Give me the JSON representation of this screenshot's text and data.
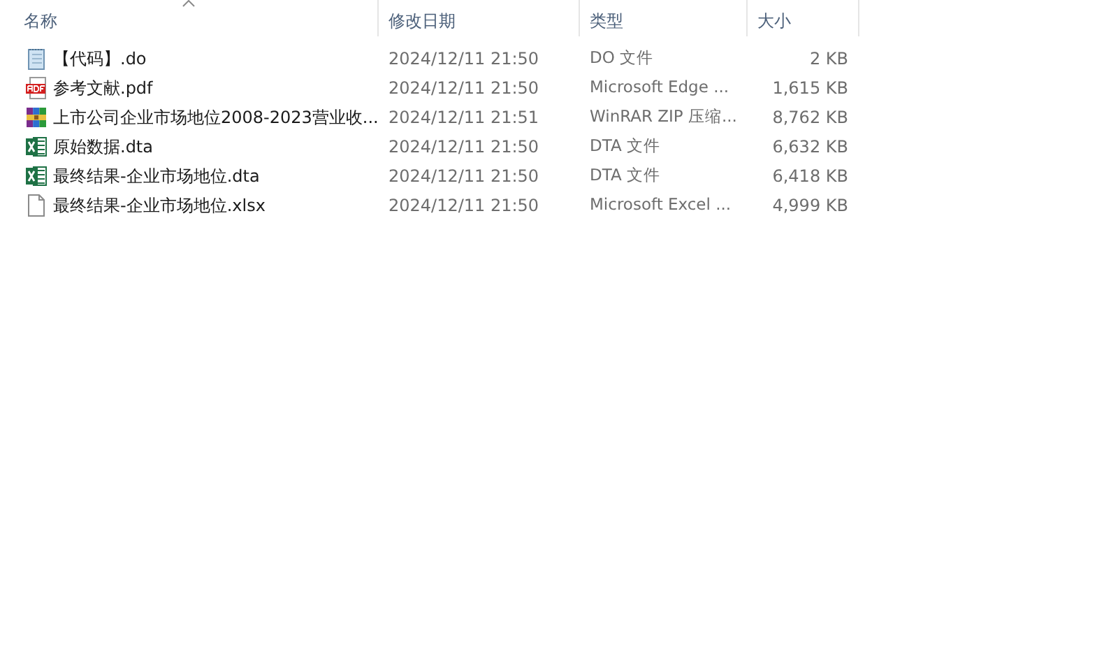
{
  "columns": [
    {
      "label": "名称",
      "sorted": true
    },
    {
      "label": "修改日期",
      "sorted": false
    },
    {
      "label": "类型",
      "sorted": false
    },
    {
      "label": "大小",
      "sorted": false
    }
  ],
  "files": [
    {
      "kind": "text",
      "name": "【代码】.do",
      "modified": "2024/12/11 21:50",
      "type": "DO 文件",
      "size": "2 KB"
    },
    {
      "kind": "pdf",
      "name": "参考文献.pdf",
      "modified": "2024/12/11 21:50",
      "type": "Microsoft Edge ...",
      "size": "1,615 KB"
    },
    {
      "kind": "archive",
      "name": "上市公司企业市场地位2008-2023营业收...",
      "modified": "2024/12/11 21:51",
      "type": "WinRAR ZIP 压缩...",
      "size": "8,762 KB"
    },
    {
      "kind": "excel",
      "name": "原始数据.dta",
      "modified": "2024/12/11 21:50",
      "type": "DTA 文件",
      "size": "6,632 KB"
    },
    {
      "kind": "excel",
      "name": "最终结果-企业市场地位.dta",
      "modified": "2024/12/11 21:50",
      "type": "DTA 文件",
      "size": "6,418 KB"
    },
    {
      "kind": "blank",
      "name": "最终结果-企业市场地位.xlsx",
      "modified": "2024/12/11 21:50",
      "type": "Microsoft Excel ...",
      "size": "4,999 KB"
    }
  ]
}
